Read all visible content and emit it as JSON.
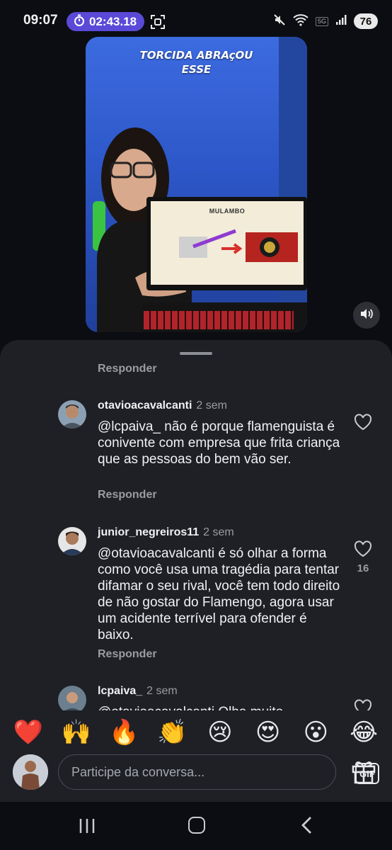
{
  "status_bar": {
    "time": "09:07",
    "recording_timer": "02:43.18",
    "network_badge": "5G",
    "battery": "76",
    "icons": [
      "stopwatch-icon",
      "screenshot-icon",
      "mute-icon",
      "wifi-icon",
      "signal-icon"
    ]
  },
  "video": {
    "caption_line1": "TORCIDA ABRAçOU",
    "caption_line2": "ESSE",
    "slide_title": "MULAMBO",
    "mute_icon": "speaker-icon"
  },
  "comments": {
    "top_reply_label": "Responder",
    "items": [
      {
        "username": "otavioacavalcanti",
        "time": "2 sem",
        "mention": "@lcpaiva_",
        "body": " não é porque flamenguista é conivente com empresa que frita criança que as pessoas do bem vão ser.",
        "reply_label": "Responder",
        "likes": ""
      },
      {
        "username": "junior_negreiros11",
        "time": "2 sem",
        "mention": "@otavioacavalcanti",
        "body": " é só olhar a forma como você usa uma tragédia para tentar difamar o seu rival, você tem todo direito de não gostar do Flamengo, agora usar um acidente terrível para ofender é baixo.",
        "reply_label": "Responder",
        "likes": "16"
      },
      {
        "username": "lcpaiva_",
        "time": "2 sem",
        "mention": "@otavioacavalcanti",
        "body": " Olha muito",
        "reply_label": "",
        "likes": ""
      }
    ]
  },
  "reactions": [
    "❤️",
    "🙌",
    "🔥",
    "👏",
    "😢",
    "😍",
    "😮",
    "😂"
  ],
  "composer": {
    "placeholder": "Participe da conversa...",
    "gif_label": "GIF"
  },
  "colors": {
    "sheet_bg": "#1e2025",
    "recording_pill": "#5b49d8",
    "muted_text": "#9a9ca2"
  }
}
